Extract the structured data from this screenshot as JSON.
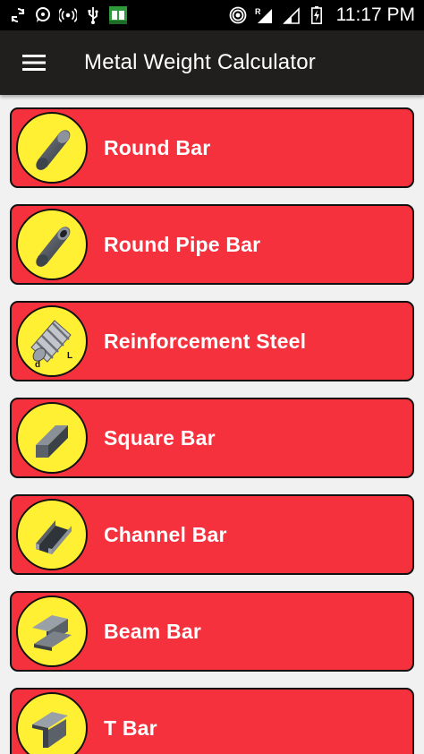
{
  "status_bar": {
    "time": "11:17 PM",
    "left_icons": [
      "sync-icon",
      "chat-icon",
      "broadcast-icon",
      "usb-icon",
      "app-icon"
    ],
    "right_icons": [
      "hotspot-icon",
      "signal-icon",
      "signal-icon",
      "battery-charging-icon"
    ],
    "roaming_label": "R"
  },
  "toolbar": {
    "title": "Metal Weight Calculator",
    "menu_icon": "hamburger-menu-icon"
  },
  "items": [
    {
      "label": "Round Bar",
      "icon": "round-bar-icon"
    },
    {
      "label": "Round Pipe Bar",
      "icon": "round-pipe-icon"
    },
    {
      "label": "Reinforcement Steel",
      "icon": "rebar-icon"
    },
    {
      "label": "Square Bar",
      "icon": "square-bar-icon"
    },
    {
      "label": "Channel Bar",
      "icon": "channel-bar-icon"
    },
    {
      "label": "Beam Bar",
      "icon": "beam-bar-icon"
    },
    {
      "label": "T Bar",
      "icon": "t-bar-icon"
    }
  ],
  "colors": {
    "item_background": "#f4313c",
    "icon_circle": "#fff033",
    "toolbar": "#211f1e",
    "page_background": "#f1f1f1"
  }
}
